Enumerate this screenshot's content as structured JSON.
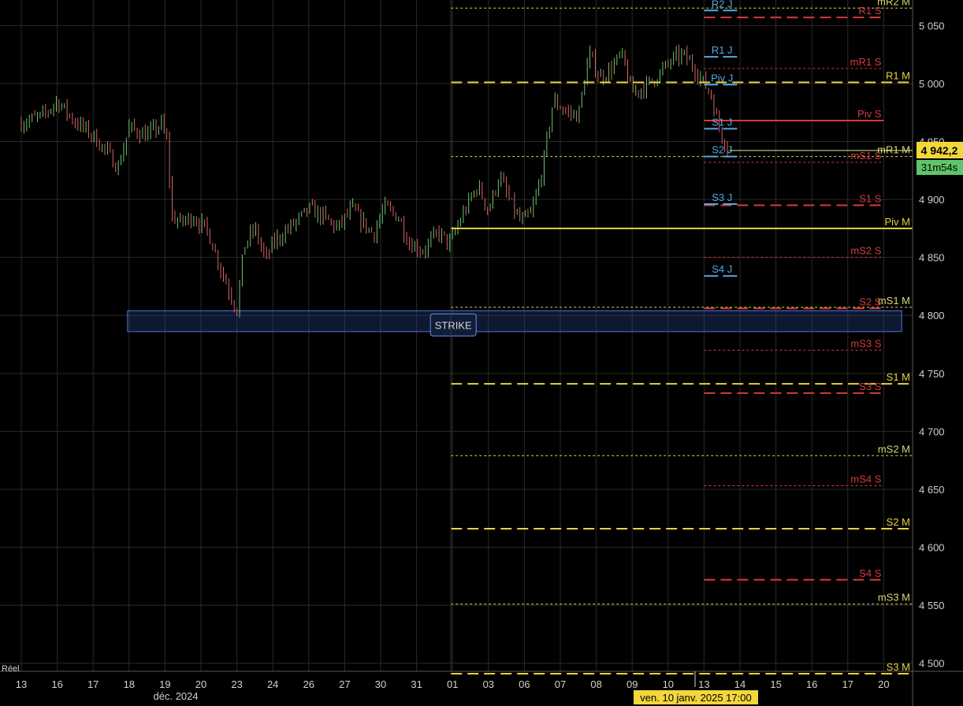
{
  "chart_data": {
    "type": "candlestick",
    "mode_label": "Réel",
    "y_axis": {
      "range": [
        4493,
        5072
      ],
      "ticks": [
        {
          "value": 4500,
          "label": "4 500"
        },
        {
          "value": 4550,
          "label": "4 550"
        },
        {
          "value": 4600,
          "label": "4 600"
        },
        {
          "value": 4650,
          "label": "4 650"
        },
        {
          "value": 4700,
          "label": "4 700"
        },
        {
          "value": 4750,
          "label": "4 750"
        },
        {
          "value": 4800,
          "label": "4 800"
        },
        {
          "value": 4850,
          "label": "4 850"
        },
        {
          "value": 4900,
          "label": "4 900"
        },
        {
          "value": 4950,
          "label": "4 950"
        },
        {
          "value": 5000,
          "label": "5 000"
        },
        {
          "value": 5050,
          "label": "5 050"
        }
      ]
    },
    "x_axis": {
      "ticks": [
        "13",
        "16",
        "17",
        "18",
        "19",
        "20",
        "23",
        "24",
        "26",
        "27",
        "30",
        "31",
        "01",
        "03",
        "06",
        "07",
        "08",
        "09",
        "10",
        "13",
        "14",
        "15",
        "16",
        "17",
        "20"
      ],
      "sub_label": "déc. 2024",
      "cursor_label": "ven. 10 janv. 2025 17:00"
    },
    "last_price": {
      "value": 4942.2,
      "label": "4 942,2",
      "countdown": "31m54s"
    },
    "zone": {
      "label": "STRIKE",
      "low": 4786,
      "high": 4804
    },
    "price_path": [
      [
        0,
        4966
      ],
      [
        0.6,
        4972
      ],
      [
        1.0,
        4985
      ],
      [
        1.5,
        4967
      ],
      [
        2.0,
        4955
      ],
      [
        2.4,
        4940
      ],
      [
        2.7,
        4928
      ],
      [
        3.0,
        4962
      ],
      [
        3.5,
        4955
      ],
      [
        3.9,
        4965
      ],
      [
        4.05,
        4950
      ],
      [
        4.2,
        4885
      ],
      [
        4.4,
        4880
      ],
      [
        4.8,
        4885
      ],
      [
        5.2,
        4872
      ],
      [
        5.5,
        4845
      ],
      [
        5.8,
        4820
      ],
      [
        6.0,
        4805
      ],
      [
        6.2,
        4860
      ],
      [
        6.5,
        4875
      ],
      [
        6.8,
        4848
      ],
      [
        7.0,
        4862
      ],
      [
        7.4,
        4874
      ],
      [
        7.8,
        4885
      ],
      [
        8.0,
        4892
      ],
      [
        8.4,
        4885
      ],
      [
        8.8,
        4875
      ],
      [
        9.2,
        4892
      ],
      [
        9.5,
        4880
      ],
      [
        9.8,
        4870
      ],
      [
        10.1,
        4893
      ],
      [
        10.5,
        4885
      ],
      [
        10.8,
        4862
      ],
      [
        11.2,
        4856
      ],
      [
        11.6,
        4872
      ],
      [
        11.9,
        4862
      ],
      [
        12.0,
        4867
      ],
      [
        12.3,
        4888
      ],
      [
        12.7,
        4912
      ],
      [
        13.0,
        4890
      ],
      [
        13.3,
        4920
      ],
      [
        13.6,
        4898
      ],
      [
        13.9,
        4880
      ],
      [
        14.2,
        4888
      ],
      [
        14.5,
        4925
      ],
      [
        14.8,
        4985
      ],
      [
        15.2,
        4975
      ],
      [
        15.5,
        4972
      ],
      [
        15.8,
        5025
      ],
      [
        16.1,
        5005
      ],
      [
        16.4,
        5012
      ],
      [
        16.7,
        5025
      ],
      [
        17.0,
        4992
      ],
      [
        17.4,
        4998
      ],
      [
        17.8,
        5010
      ],
      [
        18.1,
        5020
      ],
      [
        18.4,
        5025
      ],
      [
        18.7,
        5015
      ],
      [
        19.0,
        5000
      ],
      [
        19.2,
        4990
      ],
      [
        19.35,
        4970
      ],
      [
        19.5,
        4955
      ],
      [
        19.7,
        4942
      ]
    ],
    "levels": [
      {
        "label": "mR2 M",
        "value": 5065,
        "color": "#d8d86a",
        "style": "dotted",
        "x0": 12.0,
        "x1": 25.0
      },
      {
        "label": "mR1 M",
        "value": 4937,
        "color": "#d8d86a",
        "style": "dotted",
        "x0": 12.0,
        "x1": 25.0
      },
      {
        "label": "mS1 M",
        "value": 4807,
        "color": "#d8d86a",
        "style": "dotted",
        "x0": 12.0,
        "x1": 25.0
      },
      {
        "label": "mS2 M",
        "value": 4679,
        "color": "#d8d86a",
        "style": "dotted",
        "x0": 12.0,
        "x1": 25.0
      },
      {
        "label": "mS3 M",
        "value": 4551,
        "color": "#d8d86a",
        "style": "dotted",
        "x0": 12.0,
        "x1": 25.0
      },
      {
        "label": "R1 M",
        "value": 5001,
        "color": "#e8d23a",
        "style": "dashed",
        "x0": 12.0,
        "x1": 25.0
      },
      {
        "label": "Piv M",
        "value": 4875,
        "color": "#e8d23a",
        "style": "solid",
        "x0": 12.0,
        "x1": 25.0
      },
      {
        "label": "S1 M",
        "value": 4741,
        "color": "#e8d23a",
        "style": "dashed",
        "x0": 12.0,
        "x1": 25.0
      },
      {
        "label": "S2 M",
        "value": 4616,
        "color": "#e8d23a",
        "style": "dashed",
        "x0": 12.0,
        "x1": 25.0
      },
      {
        "label": "S3 M",
        "value": 4491,
        "color": "#e8d23a",
        "style": "dashed",
        "x0": 12.0,
        "x1": 25.0
      },
      {
        "label": "R1 S",
        "value": 5057,
        "color": "#d63a3a",
        "style": "dashed",
        "x0": 19.0,
        "x1": 24.0
      },
      {
        "label": "mR1 S",
        "value": 5013,
        "color": "#d63a3a",
        "style": "dotted",
        "x0": 19.0,
        "x1": 24.0
      },
      {
        "label": "Piv S",
        "value": 4968,
        "color": "#d63a3a",
        "style": "solid",
        "x0": 19.0,
        "x1": 24.0
      },
      {
        "label": "mS1 S",
        "value": 4932,
        "color": "#d63a3a",
        "style": "dotted",
        "x0": 19.0,
        "x1": 24.0
      },
      {
        "label": "S1 S",
        "value": 4895,
        "color": "#d63a3a",
        "style": "dashed",
        "x0": 19.0,
        "x1": 24.0
      },
      {
        "label": "mS2 S",
        "value": 4850,
        "color": "#d63a3a",
        "style": "dotted",
        "x0": 19.0,
        "x1": 24.0
      },
      {
        "label": "S2 S",
        "value": 4806,
        "color": "#d63a3a",
        "style": "dashed",
        "x0": 19.0,
        "x1": 24.0
      },
      {
        "label": "mS3 S",
        "value": 4770,
        "color": "#d63a3a",
        "style": "dotted",
        "x0": 19.0,
        "x1": 24.0
      },
      {
        "label": "S3 S",
        "value": 4733,
        "color": "#d63a3a",
        "style": "dashed",
        "x0": 19.0,
        "x1": 24.0
      },
      {
        "label": "mS4 S",
        "value": 4653,
        "color": "#d63a3a",
        "style": "dotted",
        "x0": 19.0,
        "x1": 24.0
      },
      {
        "label": "S4 S",
        "value": 4572,
        "color": "#d63a3a",
        "style": "dashed",
        "x0": 19.0,
        "x1": 24.0
      },
      {
        "label": "R2 J",
        "value": 5063,
        "color": "#56a8e6",
        "style": "dashed",
        "x0": 19.0,
        "x1": 20.0
      },
      {
        "label": "R1 J",
        "value": 5023,
        "color": "#56a8e6",
        "style": "dashed",
        "x0": 19.0,
        "x1": 20.0
      },
      {
        "label": "Piv J",
        "value": 4999,
        "color": "#56a8e6",
        "style": "dashed",
        "x0": 19.0,
        "x1": 20.0
      },
      {
        "label": "S1 J",
        "value": 4961,
        "color": "#56a8e6",
        "style": "dashed",
        "x0": 19.0,
        "x1": 20.0
      },
      {
        "label": "S2 J",
        "value": 4937,
        "color": "#56a8e6",
        "style": "dashed",
        "x0": 19.0,
        "x1": 20.0
      },
      {
        "label": "S3 J",
        "value": 4896,
        "color": "#56a8e6",
        "style": "dashed",
        "x0": 19.0,
        "x1": 20.0
      },
      {
        "label": "S4 J",
        "value": 4834,
        "color": "#56a8e6",
        "style": "dashed",
        "x0": 19.0,
        "x1": 20.0
      }
    ],
    "colors": {
      "background": "#000000",
      "grid": "#2a2a2a",
      "up": "#6ec46e",
      "down": "#d86464",
      "price_badge": "#f2d63c",
      "countdown_badge": "#5fc46a"
    }
  }
}
